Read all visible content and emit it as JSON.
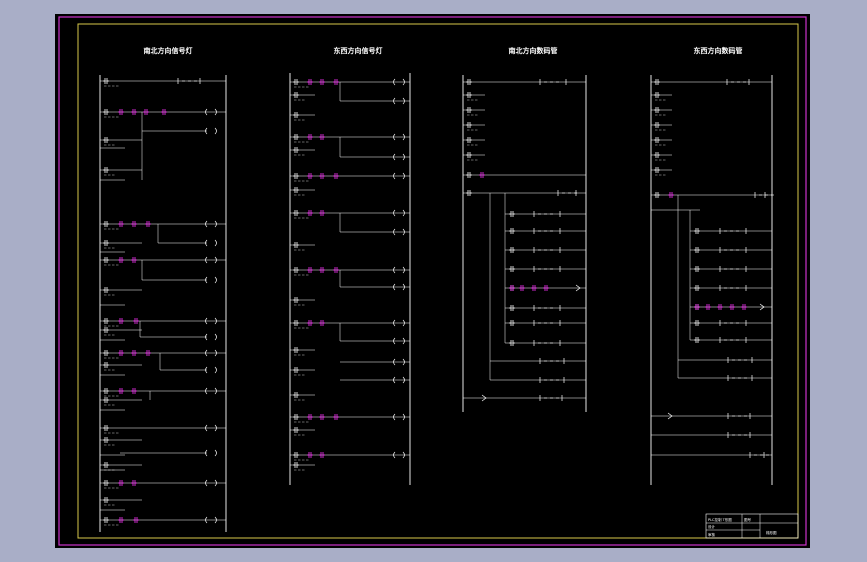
{
  "colors": {
    "app_background": "#a9aec7",
    "drawing_background": "#000000",
    "frame": "#d8c94a",
    "border": "#cc33cc",
    "wire": "#ffffff",
    "contact_highlight": "#ff33ff"
  },
  "sheet": {
    "column_titles": [
      "南北方向信号灯",
      "东西方向信号灯",
      "南北方向数码管",
      "东西方向数码管"
    ],
    "title_block": {
      "drawing_name": "PLC控制 T形图",
      "row_labels": [
        "设计",
        "审核"
      ],
      "stamp": "图号",
      "right_label": "梯形图"
    }
  }
}
